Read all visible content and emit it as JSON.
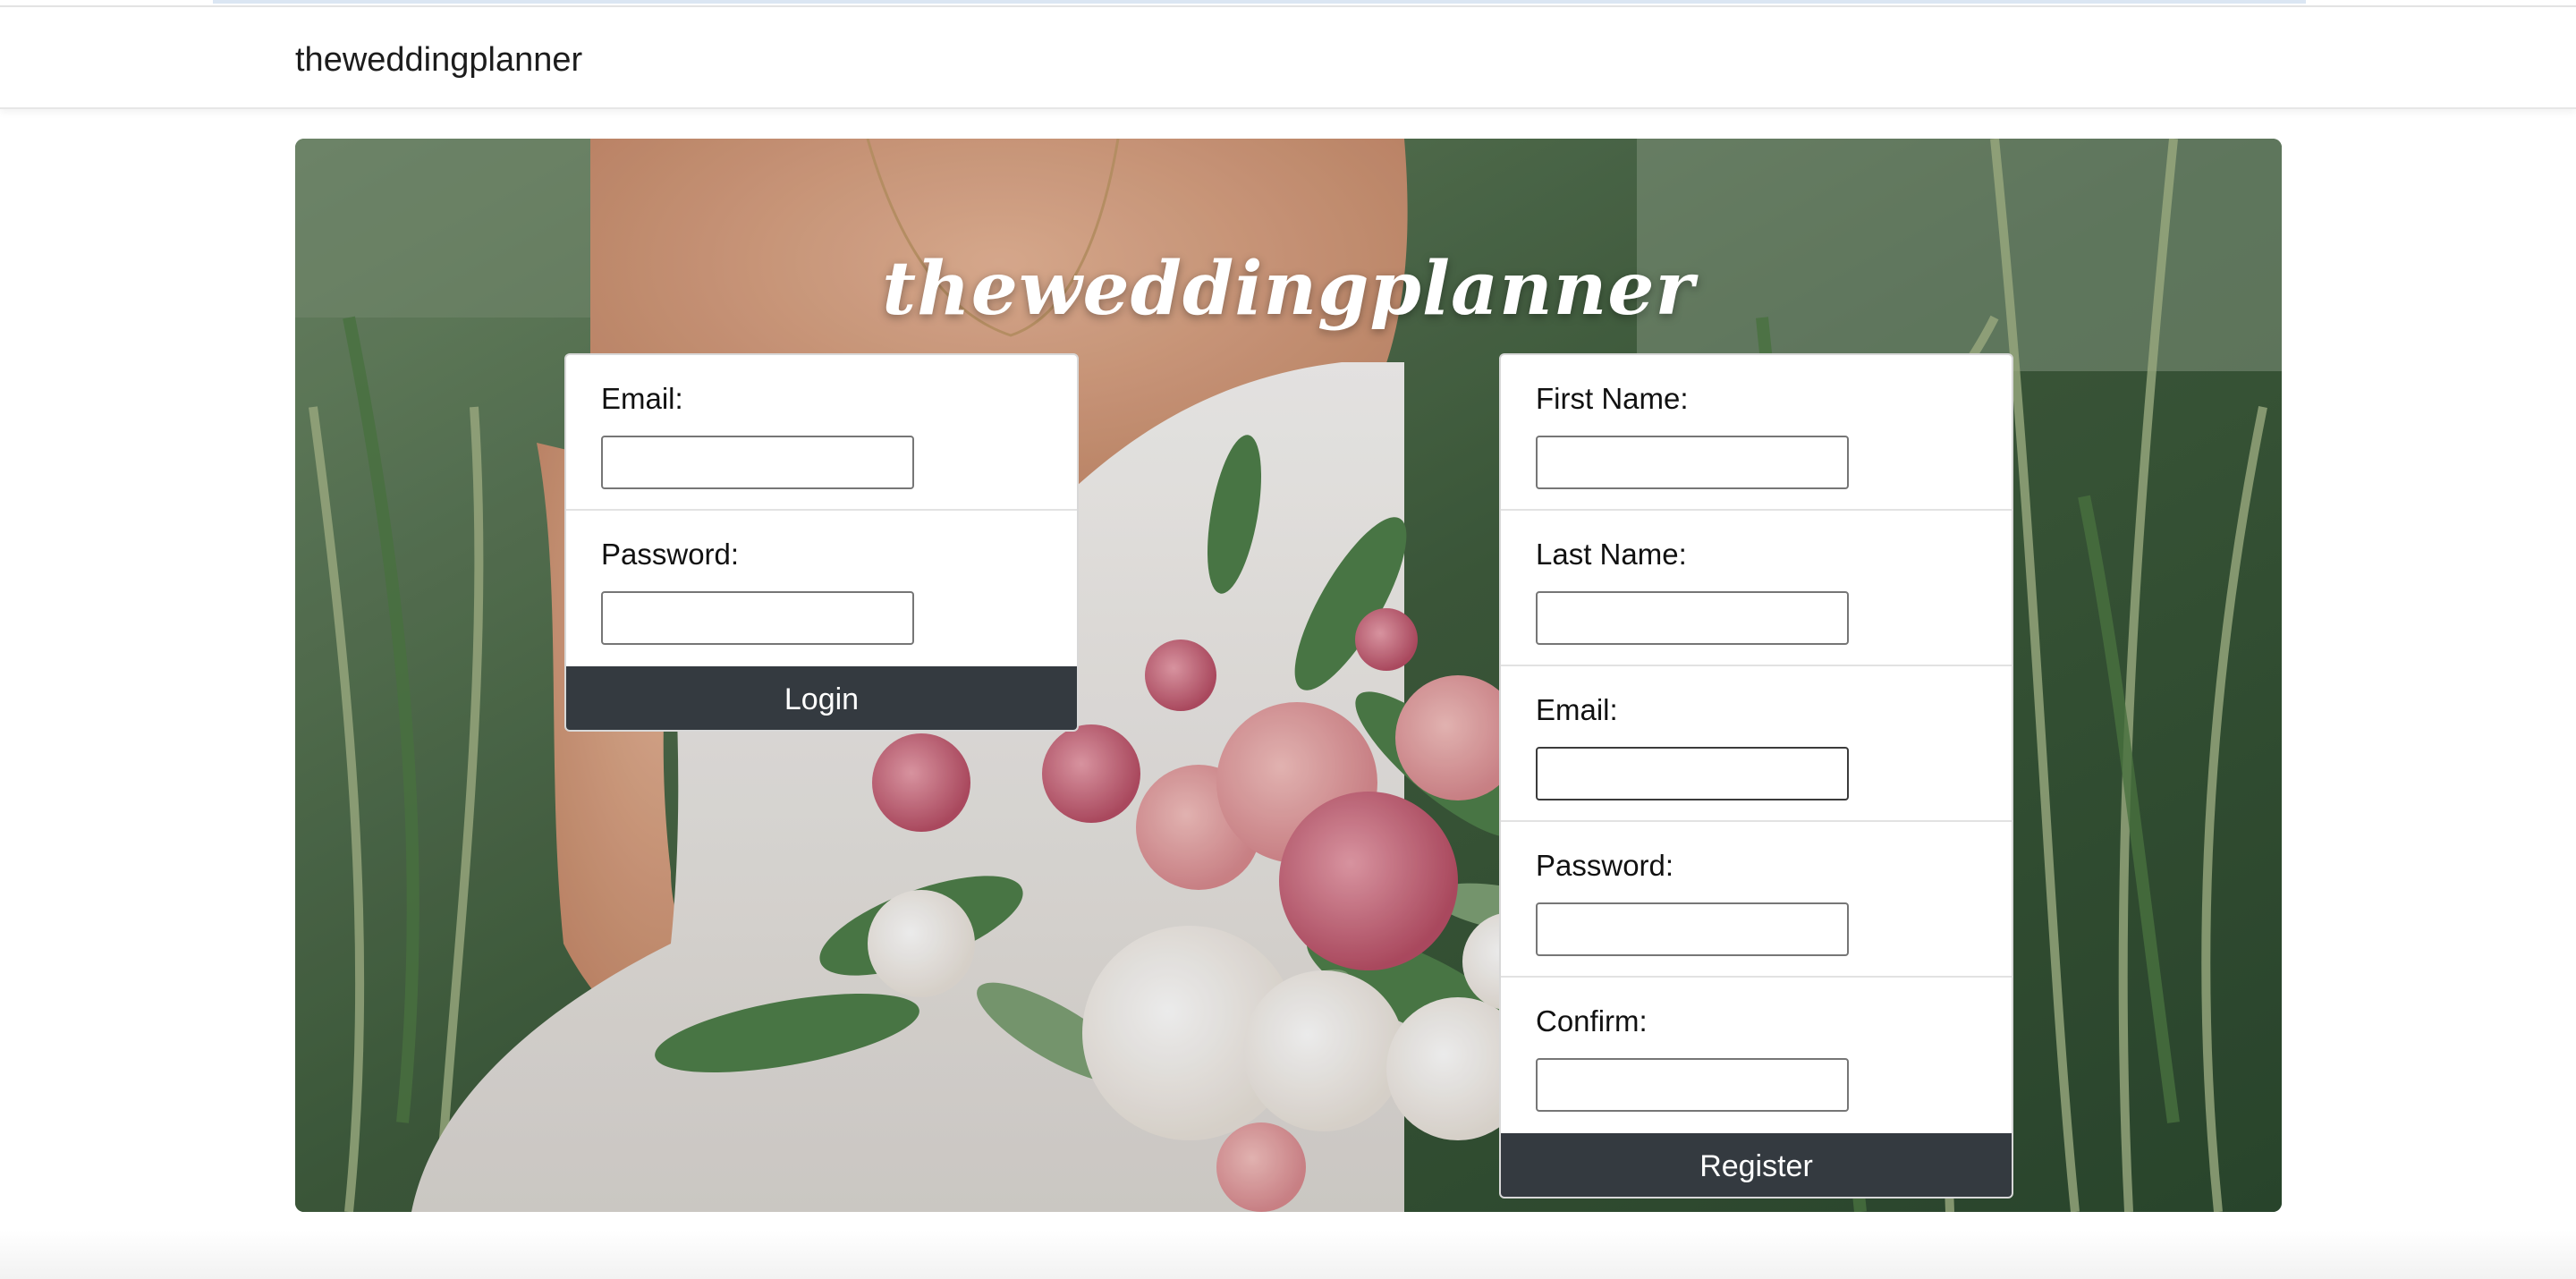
{
  "navbar": {
    "brand": "theweddingplanner"
  },
  "hero": {
    "title": "theweddingplanner"
  },
  "login": {
    "fields": [
      {
        "label": "Email:",
        "value": ""
      },
      {
        "label": "Password:",
        "value": ""
      }
    ],
    "button_label": "Login"
  },
  "register": {
    "fields": [
      {
        "label": "First Name:",
        "value": ""
      },
      {
        "label": "Last Name:",
        "value": ""
      },
      {
        "label": "Email:",
        "value": ""
      },
      {
        "label": "Password:",
        "value": ""
      },
      {
        "label": "Confirm:",
        "value": ""
      }
    ],
    "button_label": "Register"
  },
  "colors": {
    "button_bg": "#343a40",
    "foliage": "#3d5a3e",
    "dress": "#f4f1ee",
    "rose_pink": "#e69aa0",
    "peony": "#d9667e"
  }
}
